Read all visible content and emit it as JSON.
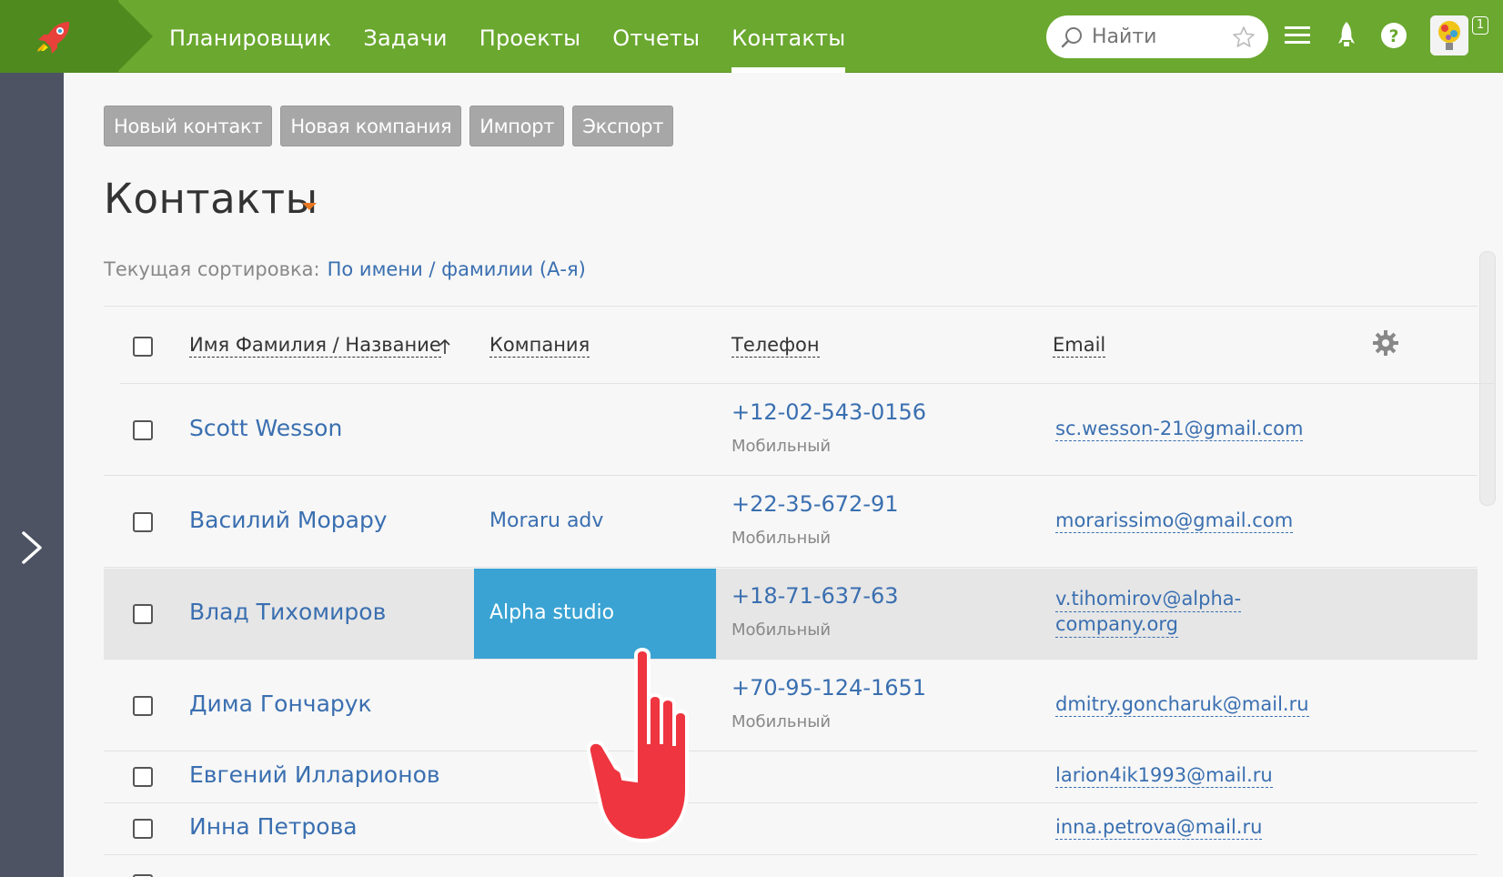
{
  "topbar": {
    "logo_icon": "rocket-logo-icon",
    "nav": [
      {
        "label": "Планировщик",
        "active": false
      },
      {
        "label": "Задачи",
        "active": false
      },
      {
        "label": "Проекты",
        "active": false
      },
      {
        "label": "Отчеты",
        "active": false
      },
      {
        "label": "Контакты",
        "active": true
      }
    ],
    "search_placeholder": "Найти",
    "notification_count": "1",
    "accent_color": "#6aa82f"
  },
  "actions": {
    "new_contact": "Новый контакт",
    "new_company": "Новая компания",
    "import": "Импорт",
    "export": "Экспорт"
  },
  "page": {
    "title": "Контакты",
    "sorting_label": "Текущая сортировка:",
    "sorting_value": "По имени / фамилии (А-я)"
  },
  "table": {
    "headers": {
      "name": "Имя Фамилия / Название",
      "company": "Компания",
      "phone": "Телефон",
      "email": "Email"
    },
    "rows": [
      {
        "name": "Scott Wesson",
        "company": "",
        "phone": "+12-02-543-0156",
        "phone_type": "Мобильный",
        "email": "sc.wesson-21@gmail.com"
      },
      {
        "name": "Василий Морару",
        "company": "Moraru adv",
        "phone": "+22-35-672-91",
        "phone_type": "Мобильный",
        "email": "morarissimo@gmail.com"
      },
      {
        "name": "Влад Тихомиров",
        "company": "Alpha studio",
        "phone": "+18-71-637-63",
        "phone_type": "Мобильный",
        "email_line1": "v.tihomirov@alpha-",
        "email_line2": "company.org"
      },
      {
        "name": "Дима Гончарук",
        "company": "",
        "phone": "+70-95-124-1651",
        "phone_type": "Мобильный",
        "email": "dmitry.goncharuk@mail.ru"
      },
      {
        "name": "Евгений Илларионов",
        "company": "",
        "phone": "",
        "phone_type": "",
        "email": "larion4ik1993@mail.ru"
      },
      {
        "name": "Инна Петрова",
        "company": "",
        "phone": "",
        "phone_type": "",
        "email": "inna.petrova@mail.ru"
      }
    ]
  }
}
